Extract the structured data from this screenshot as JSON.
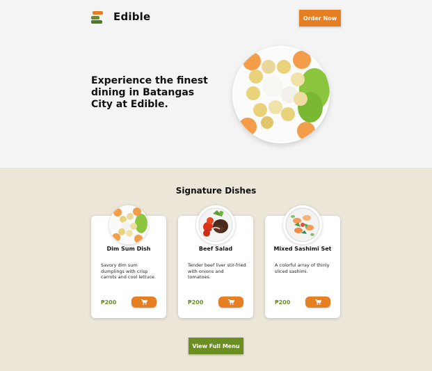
{
  "header": {
    "brand": "Edible",
    "cta_label": "Order Now",
    "logo_icon": "edible-logo-icon"
  },
  "hero": {
    "headline": "Experience the finest dining in Batangas City at Edible.",
    "image": "dim-sum-plate-image"
  },
  "signature": {
    "title": "Signature Dishes",
    "dishes": [
      {
        "name": "Dim Sum Dish",
        "description": "Savory dim sum dumplings with crisp carrots and cool lettuce.",
        "price": "₱200",
        "image": "dim-sum-image"
      },
      {
        "name": "Beef Salad",
        "description": "Tender beef liver stir-fried with onions and tomatoes.",
        "price": "₱200",
        "image": "beef-salad-image"
      },
      {
        "name": "Mixed Sashimi Set",
        "description": "A colorful array of thinly sliced sashimi.",
        "price": "₱200",
        "image": "sashimi-image"
      }
    ],
    "cart_icon": "cart-icon"
  },
  "footer": {
    "menu_label": "View Full Menu"
  },
  "colors": {
    "accent_orange": "#e67e22",
    "accent_green": "#6b8e23",
    "section_bg": "#ece6d9",
    "hero_bg": "#f4f4f4"
  }
}
